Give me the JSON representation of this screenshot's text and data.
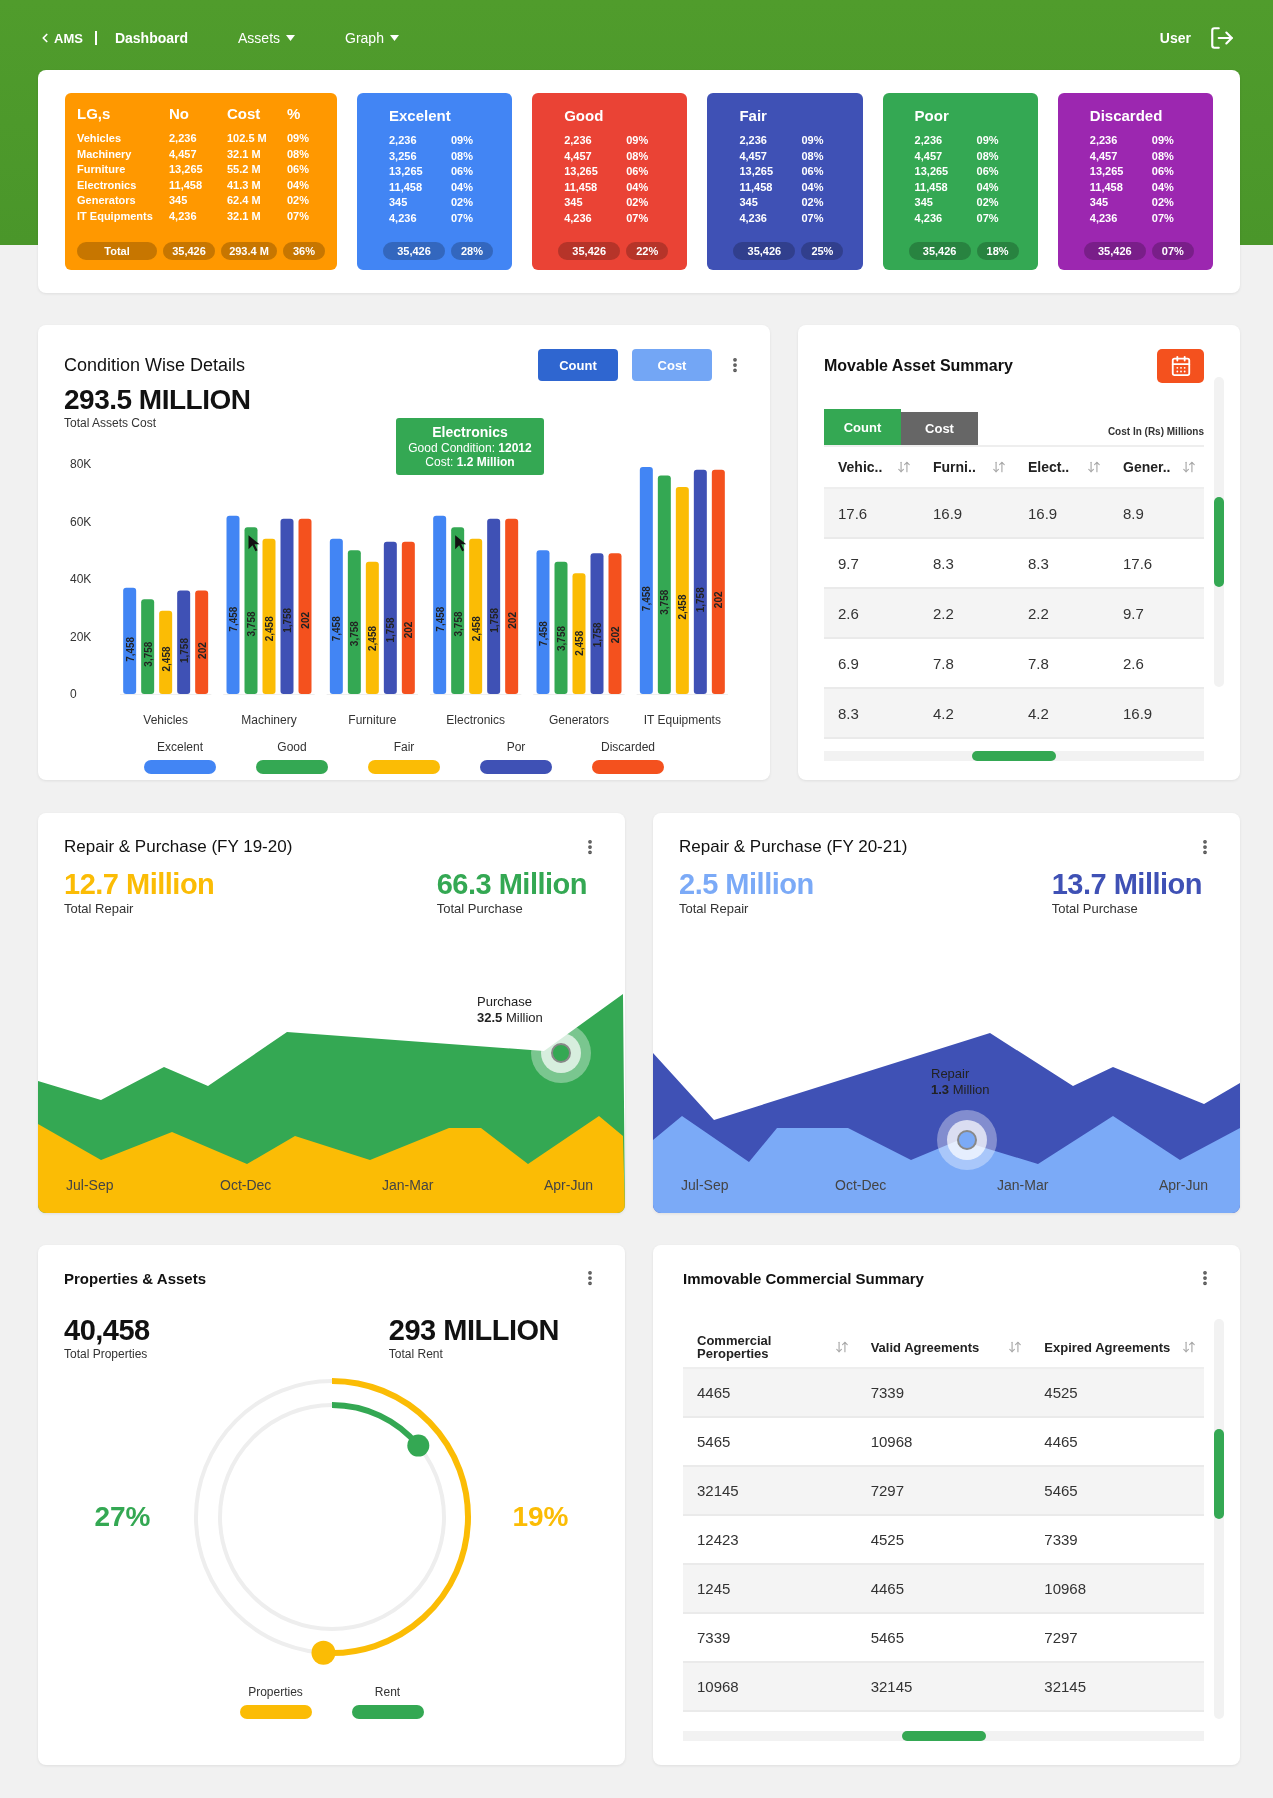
{
  "nav": {
    "back": "AMS",
    "items": [
      {
        "label": "Dashboard",
        "dropdown": false,
        "selected": true
      },
      {
        "label": "Assets",
        "dropdown": true,
        "selected": false
      },
      {
        "label": "Graph",
        "dropdown": true,
        "selected": false
      }
    ],
    "user": "User"
  },
  "summary": {
    "lgs": {
      "color": "#ff9800",
      "headers": [
        "LG,s",
        "No",
        "Cost",
        "%"
      ],
      "rows": [
        [
          "Vehicles",
          "2,236",
          "102.5 M",
          "09%"
        ],
        [
          "Machinery",
          "4,457",
          "32.1 M",
          "08%"
        ],
        [
          "Furniture",
          "13,265",
          "55.2 M",
          "06%"
        ],
        [
          "Electronics",
          "11,458",
          "41.3 M",
          "04%"
        ],
        [
          "Generators",
          "345",
          "62.4 M",
          "02%"
        ],
        [
          "IT Equipments",
          "4,236",
          "32.1 M",
          "07%"
        ]
      ],
      "total": [
        "Total",
        "35,426",
        "293.4 M",
        "36%"
      ]
    },
    "conditions": [
      {
        "title": "Excelent",
        "color": "#4285f4",
        "rows": [
          [
            "2,236",
            "09%"
          ],
          [
            "3,256",
            "08%"
          ],
          [
            "13,265",
            "06%"
          ],
          [
            "11,458",
            "04%"
          ],
          [
            "345",
            "02%"
          ],
          [
            "4,236",
            "07%"
          ]
        ],
        "total": [
          "35,426",
          "28%"
        ]
      },
      {
        "title": "Good",
        "color": "#ea4335",
        "rows": [
          [
            "2,236",
            "09%"
          ],
          [
            "4,457",
            "08%"
          ],
          [
            "13,265",
            "06%"
          ],
          [
            "11,458",
            "04%"
          ],
          [
            "345",
            "02%"
          ],
          [
            "4,236",
            "07%"
          ]
        ],
        "total": [
          "35,426",
          "22%"
        ]
      },
      {
        "title": "Fair",
        "color": "#3f51b5",
        "rows": [
          [
            "2,236",
            "09%"
          ],
          [
            "4,457",
            "08%"
          ],
          [
            "13,265",
            "06%"
          ],
          [
            "11,458",
            "04%"
          ],
          [
            "345",
            "02%"
          ],
          [
            "4,236",
            "07%"
          ]
        ],
        "total": [
          "35,426",
          "25%"
        ]
      },
      {
        "title": "Poor",
        "color": "#34a853",
        "rows": [
          [
            "2,236",
            "09%"
          ],
          [
            "4,457",
            "08%"
          ],
          [
            "13,265",
            "06%"
          ],
          [
            "11,458",
            "04%"
          ],
          [
            "345",
            "02%"
          ],
          [
            "4,236",
            "07%"
          ]
        ],
        "total": [
          "35,426",
          "18%"
        ]
      },
      {
        "title": "Discarded",
        "color": "#9c27b0",
        "rows": [
          [
            "2,236",
            "09%"
          ],
          [
            "4,457",
            "08%"
          ],
          [
            "13,265",
            "06%"
          ],
          [
            "11,458",
            "04%"
          ],
          [
            "345",
            "02%"
          ],
          [
            "4,236",
            "07%"
          ]
        ],
        "total": [
          "35,426",
          "07%"
        ]
      }
    ]
  },
  "condition_details": {
    "title": "Condition Wise Details",
    "toggles": [
      {
        "label": "Count",
        "selected": true
      },
      {
        "label": "Cost",
        "selected": false
      }
    ],
    "total": "293.5 MILLION",
    "total_label": "Total Assets Cost",
    "tooltip": {
      "title": "Electronics",
      "lines": [
        "Good Condition: **12012**",
        "Cost: **1.2 Million**"
      ]
    },
    "chart_data": {
      "type": "bar",
      "categories": [
        "Vehicles",
        "Machinery",
        "Furniture",
        "Electronics",
        "Generators",
        "IT Equipments"
      ],
      "ylim": [
        0,
        80000
      ],
      "yticks": [
        {
          "value": 0,
          "label": "0"
        },
        {
          "value": 20000,
          "label": "20K"
        },
        {
          "value": 40000,
          "label": "40K"
        },
        {
          "value": 60000,
          "label": "60K"
        },
        {
          "value": 80000,
          "label": "80K"
        }
      ],
      "series": [
        {
          "name": "Excelent",
          "color": "#4285f4",
          "values": [
            37000,
            62000,
            54000,
            62000,
            50000,
            79000
          ]
        },
        {
          "name": "Good",
          "color": "#34a853",
          "values": [
            33000,
            58000,
            50000,
            58000,
            46000,
            76000
          ]
        },
        {
          "name": "Fair",
          "color": "#fbbc05",
          "values": [
            29000,
            54000,
            46000,
            54000,
            42000,
            72000
          ]
        },
        {
          "name": "Por",
          "color": "#3f51b5",
          "values": [
            36000,
            61000,
            53000,
            61000,
            49000,
            78000
          ]
        },
        {
          "name": "Discarded",
          "color": "#f4511e",
          "values": [
            36000,
            61000,
            53000,
            61000,
            49000,
            78000
          ]
        }
      ],
      "value_labels": [
        "7,458",
        "3,758",
        "2,458",
        "1,758",
        "202"
      ]
    }
  },
  "movable": {
    "title": "Movable Asset Summary",
    "tabs": [
      {
        "label": "Count",
        "selected": true
      },
      {
        "label": "Cost",
        "selected": false
      }
    ],
    "note": "Cost In (Rs) Millions",
    "columns": [
      "Vehic..",
      "Furni..",
      "Elect..",
      "Gener.."
    ],
    "rows": [
      [
        "17.6",
        "16.9",
        "16.9",
        "8.9"
      ],
      [
        "9.7",
        "8.3",
        "8.3",
        "17.6"
      ],
      [
        "2.6",
        "2.2",
        "2.2",
        "9.7"
      ],
      [
        "6.9",
        "7.8",
        "7.8",
        "2.6"
      ],
      [
        "8.3",
        "4.2",
        "4.2",
        "16.9"
      ]
    ]
  },
  "repair": [
    {
      "title": "Repair & Purchase (FY 19-20)",
      "stats": [
        {
          "value": "12.7 Million",
          "label": "Total Repair",
          "color": "#fbbc05"
        },
        {
          "value": "66.3 Million",
          "label": "Total Purchase",
          "color": "#34a853"
        }
      ],
      "quarters": [
        "Jul-Sep",
        "Oct-Dec",
        "Jan-Mar",
        "Apr-Jun"
      ],
      "marker": {
        "label": "Purchase",
        "value": "**32.5** Million"
      }
    },
    {
      "title": "Repair & Purchase (FY 20-21)",
      "stats": [
        {
          "value": "2.5 Million",
          "label": "Total Repair",
          "color": "#7baaf7"
        },
        {
          "value": "13.7 Million",
          "label": "Total Purchase",
          "color": "#3f51b5"
        }
      ],
      "quarters": [
        "Jul-Sep",
        "Oct-Dec",
        "Jan-Mar",
        "Apr-Jun"
      ],
      "marker": {
        "label": "Repair",
        "value": "**1.3** Million"
      }
    }
  ],
  "properties": {
    "title": "Properties & Assets",
    "stats": [
      {
        "value": "40,458",
        "label": "Total Properties"
      },
      {
        "value": "293 MILLION",
        "label": "Total Rent"
      }
    ],
    "percents": [
      {
        "value": "27%",
        "color": "#34a853"
      },
      {
        "value": "19%",
        "color": "#fbbc05"
      }
    ],
    "legend": [
      {
        "name": "Properties",
        "color": "#fbbc05"
      },
      {
        "name": "Rent",
        "color": "#34a853"
      }
    ]
  },
  "immovable": {
    "title": "Immovable Commercial Summary",
    "columns": [
      "Commercial Peroperties",
      "Valid Agreements",
      "Expired Agreements"
    ],
    "rows": [
      [
        "4465",
        "7339",
        "4525"
      ],
      [
        "5465",
        "10968",
        "4465"
      ],
      [
        "32145",
        "7297",
        "5465"
      ],
      [
        "12423",
        "4525",
        "7339"
      ],
      [
        "1245",
        "4465",
        "10968"
      ],
      [
        "7339",
        "5465",
        "7297"
      ],
      [
        "10968",
        "32145",
        "32145"
      ]
    ]
  }
}
